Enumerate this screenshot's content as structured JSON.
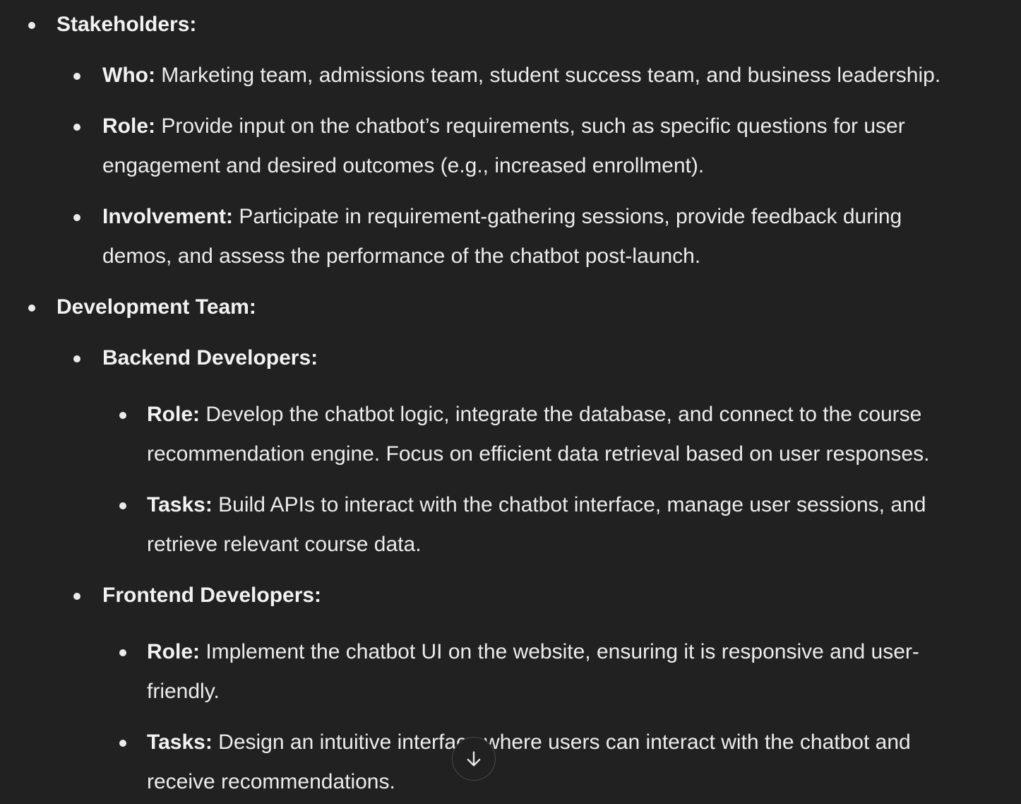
{
  "items": [
    {
      "label": "Stakeholders:",
      "text": ""
    },
    {
      "label": "Who:",
      "text": " Marketing team, admissions team, student success team, and business leadership."
    },
    {
      "label": "Role:",
      "text": " Provide input on the chatbot’s requirements, such as specific questions for user",
      "cont": "engagement and desired outcomes (e.g., increased enrollment)."
    },
    {
      "label": "Involvement:",
      "text": " Participate in requirement-gathering sessions, provide feedback during",
      "cont": "demos, and assess the performance of the chatbot post-launch."
    },
    {
      "label": "Development Team:",
      "text": ""
    },
    {
      "label": "Backend Developers:",
      "text": ""
    },
    {
      "label": "Role:",
      "text": " Develop the chatbot logic, integrate the database, and connect to the course",
      "cont": "recommendation engine. Focus on efficient data retrieval based on user responses."
    },
    {
      "label": "Tasks:",
      "text": " Build APIs to interact with the chatbot interface, manage user sessions, and",
      "cont": "retrieve relevant course data."
    },
    {
      "label": "Frontend Developers:",
      "text": ""
    },
    {
      "label": "Role:",
      "text": " Implement the chatbot UI on the website, ensuring it is responsive and user-",
      "cont": "friendly."
    },
    {
      "label": "Tasks:",
      "text": " Design an intuitive interface where users can interact with the chatbot and",
      "cont": "receive recommendations."
    }
  ],
  "scroll_button": {
    "icon": "arrow-down-icon"
  }
}
